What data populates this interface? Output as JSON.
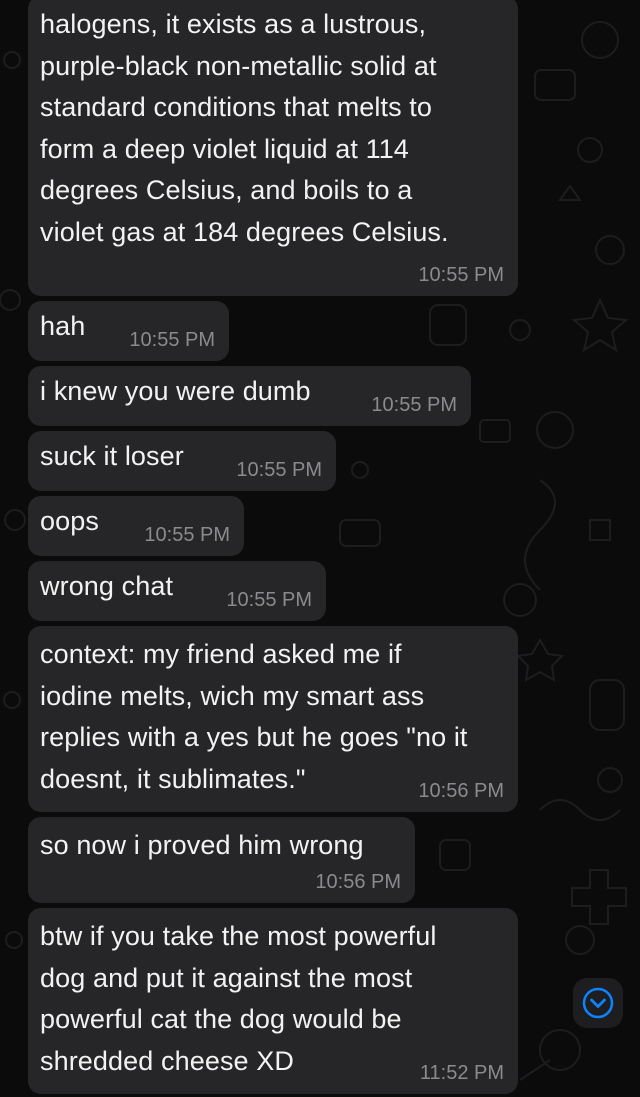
{
  "messages": [
    {
      "lines": [
        "halogens, it exists as a lustrous,",
        "purple-black non-metallic solid at",
        "standard conditions that melts to",
        "form a deep violet liquid at 114",
        "degrees Celsius, and boils to a",
        "violet gas at 184 degrees Celsius."
      ],
      "time": "10:55 PM"
    },
    {
      "lines": [
        "hah"
      ],
      "time": "10:55 PM"
    },
    {
      "lines": [
        "i knew you were dumb"
      ],
      "time": "10:55 PM"
    },
    {
      "lines": [
        "suck it loser"
      ],
      "time": "10:55 PM"
    },
    {
      "lines": [
        "oops"
      ],
      "time": "10:55 PM"
    },
    {
      "lines": [
        "wrong chat"
      ],
      "time": "10:55 PM"
    },
    {
      "lines": [
        "context: my friend asked me if",
        "iodine melts, wich my smart ass",
        "replies with a yes but he goes \"no it",
        "doesnt, it sublimates.\""
      ],
      "time": "10:56 PM"
    },
    {
      "lines": [
        "so now i proved him wrong"
      ],
      "time": "10:56 PM"
    },
    {
      "lines": [
        "btw if you take the most powerful",
        "dog and put it against the most",
        "powerful cat the dog would be",
        "shredded cheese XD"
      ],
      "time": "11:52 PM"
    }
  ],
  "colors": {
    "background": "#0b0b0b",
    "bubble": "#262628",
    "text": "#f2f2f2",
    "timestamp": "#8b8b8f",
    "scroll_icon": "#0a84ff"
  },
  "icons": {
    "scroll_to_bottom": "chevron-down-circle-icon"
  }
}
